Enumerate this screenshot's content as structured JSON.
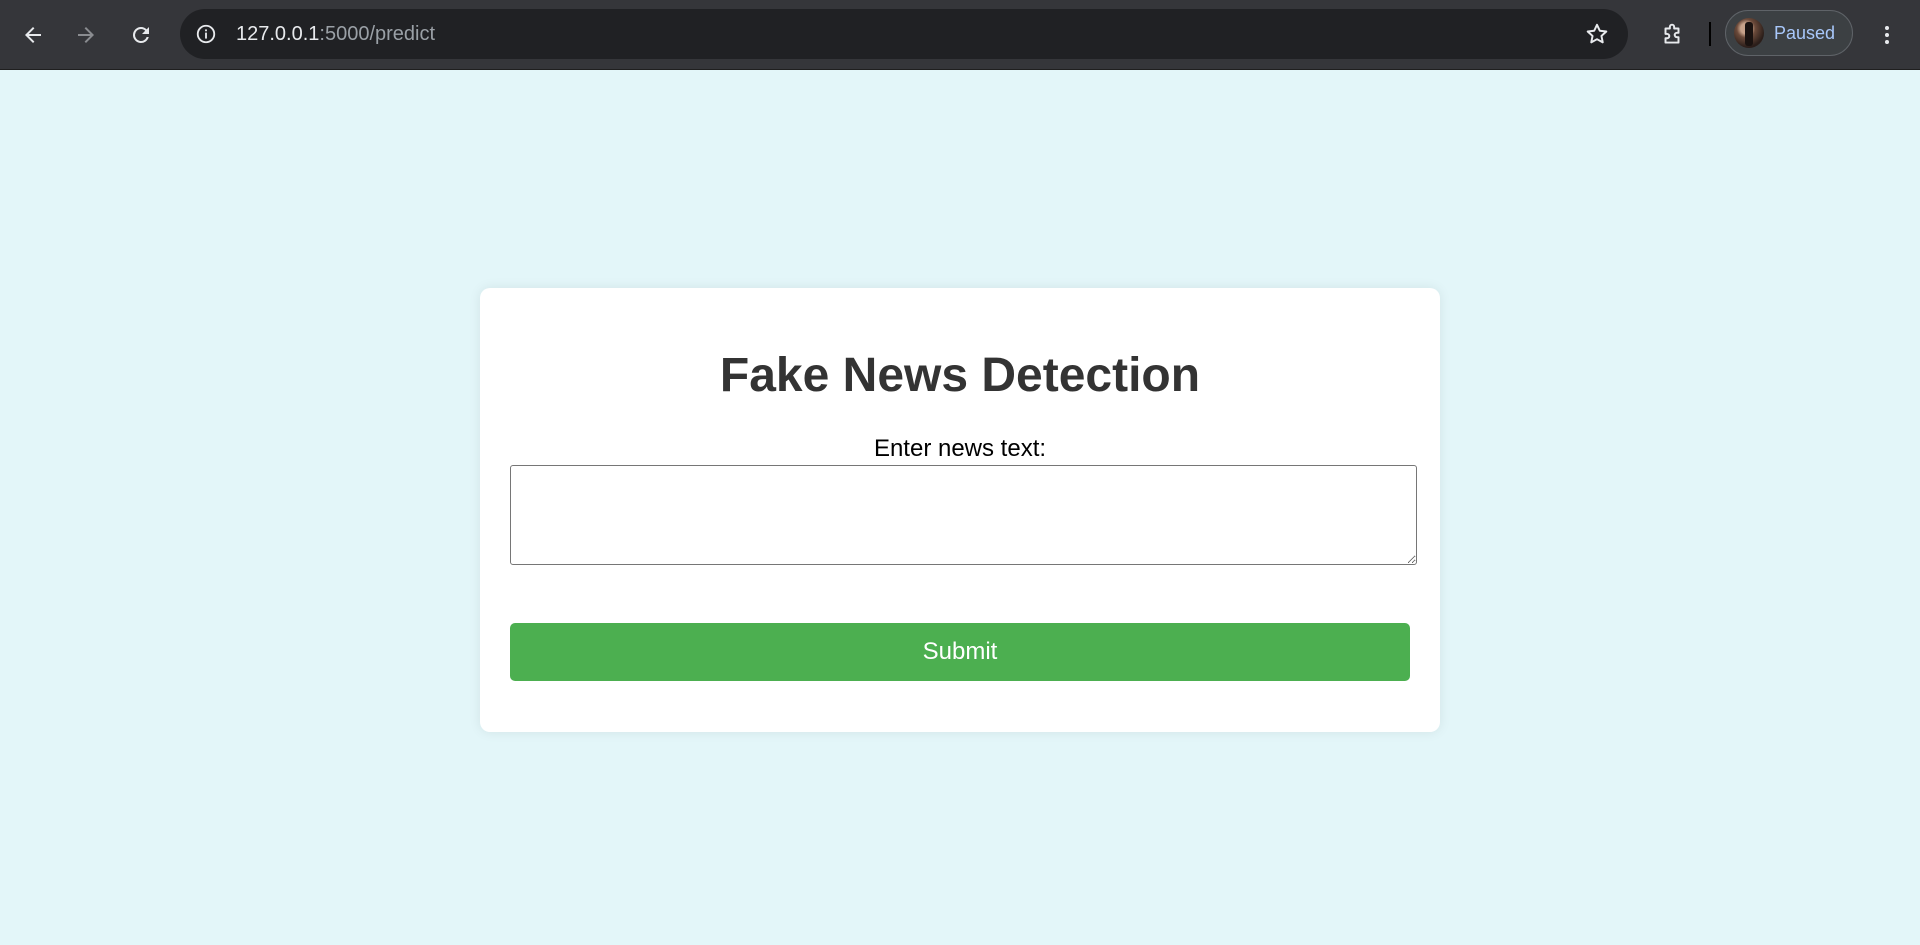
{
  "browser": {
    "url_host": "127.0.0.1",
    "url_rest": ":5000/predict",
    "profile_status": "Paused",
    "icons": {
      "back": "arrow-left-icon",
      "forward": "arrow-right-icon",
      "reload": "reload-icon",
      "site_info": "info-icon",
      "bookmark": "star-icon",
      "extensions": "puzzle-icon",
      "menu": "kebab-menu-icon"
    }
  },
  "page": {
    "title": "Fake News Detection",
    "input_label": "Enter news text:",
    "textarea_value": "",
    "submit_label": "Submit"
  },
  "colors": {
    "page_background": "#e3f6f9",
    "card_background": "#ffffff",
    "submit_background": "#4caf50",
    "title_color": "#333333"
  }
}
